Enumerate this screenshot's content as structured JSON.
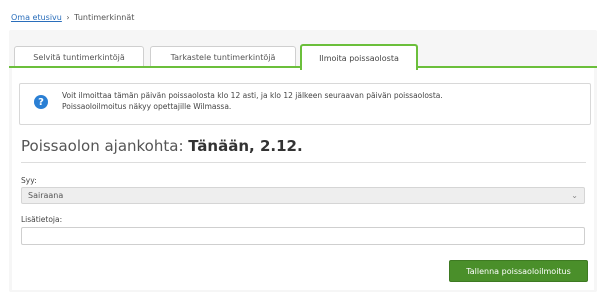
{
  "breadcrumb": {
    "home": "Oma etusivu",
    "separator": "›",
    "current": "Tuntimerkinnät"
  },
  "tabs": [
    {
      "label": "Selvitä tuntimerkintöjä",
      "active": false
    },
    {
      "label": "Tarkastele tuntimerkintöjä",
      "active": false
    },
    {
      "label": "Ilmoita poissaolosta",
      "active": true
    }
  ],
  "info": {
    "icon": "question-icon",
    "line1": "Voit ilmoittaa tämän päivän poissaolosta klo 12 asti, ja klo 12 jälkeen seuraavan päivän poissaolosta.",
    "line2": "Poissaoloilmoitus näkyy opettajille Wilmassa."
  },
  "heading": {
    "prefix": "Poissaolon ajankohta:",
    "value": "Tänään, 2.12."
  },
  "form": {
    "reason_label": "Syy:",
    "reason_value": "Sairaana",
    "details_label": "Lisätietoja:",
    "details_value": "",
    "details_placeholder": ""
  },
  "actions": {
    "save_label": "Tallenna poissaoloilmoitus"
  },
  "colors": {
    "accent": "#6bbf3b",
    "button": "#4a8f2a",
    "info_icon": "#2a7fd4",
    "link": "#2a6ebb"
  }
}
